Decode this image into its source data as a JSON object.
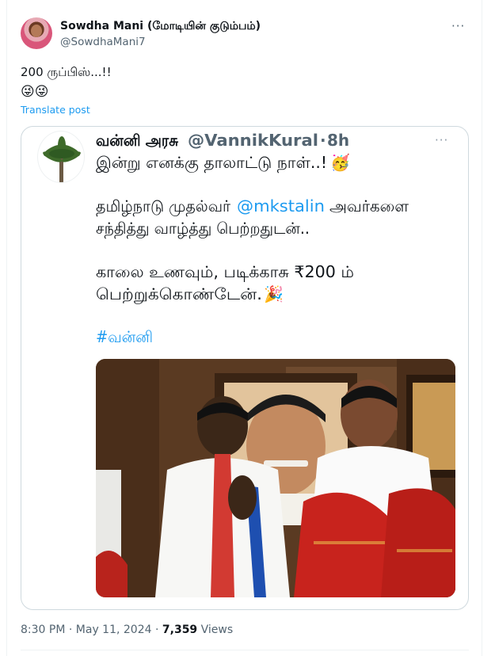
{
  "tweet": {
    "author_name": "Sowdha Mani (மோடியின் குடும்பம்)",
    "author_handle": "@SowdhaMani7",
    "text": "200 ருப்பிஸ்...!!",
    "emoji": "😜😜",
    "translate_label": "Translate post",
    "more_icon": "···"
  },
  "quoted": {
    "author_name": "வன்னி அரசு",
    "author_handle": "@VannikKural",
    "separator": "·",
    "time_ago": "8h",
    "more_icon": "···",
    "line1": "இன்று எனக்கு தாலாட்டு நாள்..!",
    "line1_emoji": "🥳",
    "line2_pre": "தமிழ்நாடு முதல்வர் ",
    "line2_mention": "@mkstalin",
    "line2_post": " அவர்களை",
    "line3": "சந்தித்து வாழ்த்து பெற்றதுடன்..",
    "line4": "காலை உணவும், படிக்காசு ₹200 ம்",
    "line5": "பெற்றுக்கொண்டேன்.",
    "line5_emoji": "🎉",
    "hashtag": "#வன்னி"
  },
  "meta": {
    "time": "8:30 PM",
    "separator": "·",
    "date": "May 11, 2024",
    "views_count": "7,359",
    "views_label": "Views"
  }
}
